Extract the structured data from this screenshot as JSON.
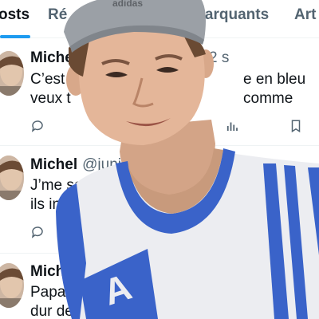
{
  "tabs": [
    {
      "label": "osts",
      "active": true
    },
    {
      "label": "Ré",
      "active": false
    },
    {
      "label": "marquants",
      "active": false
    },
    {
      "label": "Art",
      "active": false
    }
  ],
  "posts": [
    {
      "name": "Miche",
      "handle": "",
      "time": "2 s",
      "line1": "C’est",
      "line1b": "e en bleu comme",
      "line2": "veux t",
      "line2b": "?"
    },
    {
      "name": "Michel",
      "handle": "@junio",
      "line1": "J’me sens",
      "line2": "ils in"
    },
    {
      "name": "Miche",
      "handle": "",
      "line1": "Papa p",
      "line2": "dur de vo"
    }
  ],
  "icons": [
    "reply-icon",
    "repost-icon",
    "views-icon",
    "bookmark-icon"
  ],
  "overlay": {
    "cap_text": "adidas",
    "jersey_letter": "A"
  },
  "colors": {
    "accent": "#1d9bf0",
    "text": "#0f1419",
    "muted": "#536471",
    "jersey_trim": "#3a63c9"
  }
}
